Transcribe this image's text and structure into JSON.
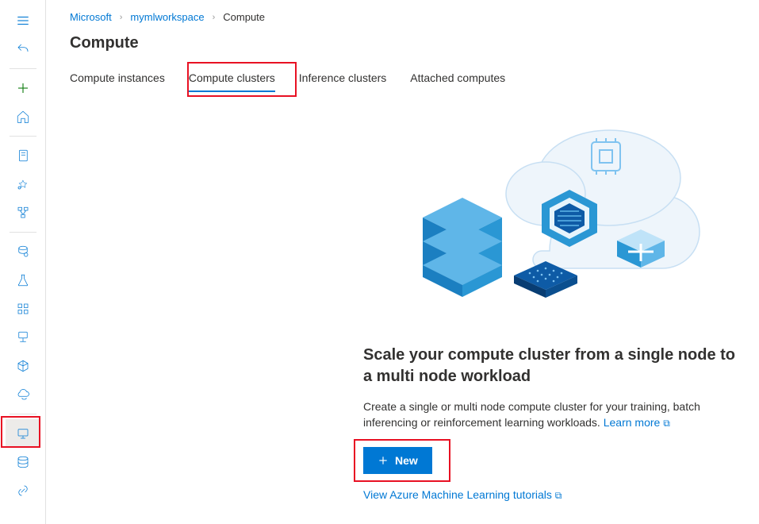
{
  "breadcrumb": {
    "items": [
      {
        "label": "Microsoft"
      },
      {
        "label": "mymlworkspace"
      }
    ],
    "current": "Compute"
  },
  "page_title": "Compute",
  "tabs": [
    {
      "label": "Compute instances"
    },
    {
      "label": "Compute clusters"
    },
    {
      "label": "Inference clusters"
    },
    {
      "label": "Attached computes"
    }
  ],
  "empty_state": {
    "heading": "Scale your compute cluster from a single node to a multi node workload",
    "description": "Create a single or multi node compute cluster for your training, batch inferencing or reinforcement learning workloads.  ",
    "learn_more": "Learn more",
    "new_button": "New",
    "tutorials_link": "View Azure Machine Learning tutorials"
  },
  "sidebar_icons": [
    "menu",
    "undo",
    "plus",
    "home",
    "notebook",
    "automl",
    "pipeline",
    "data",
    "experiment",
    "model",
    "endpoint",
    "environment",
    "cloud",
    "compute",
    "datastore",
    "linked"
  ]
}
